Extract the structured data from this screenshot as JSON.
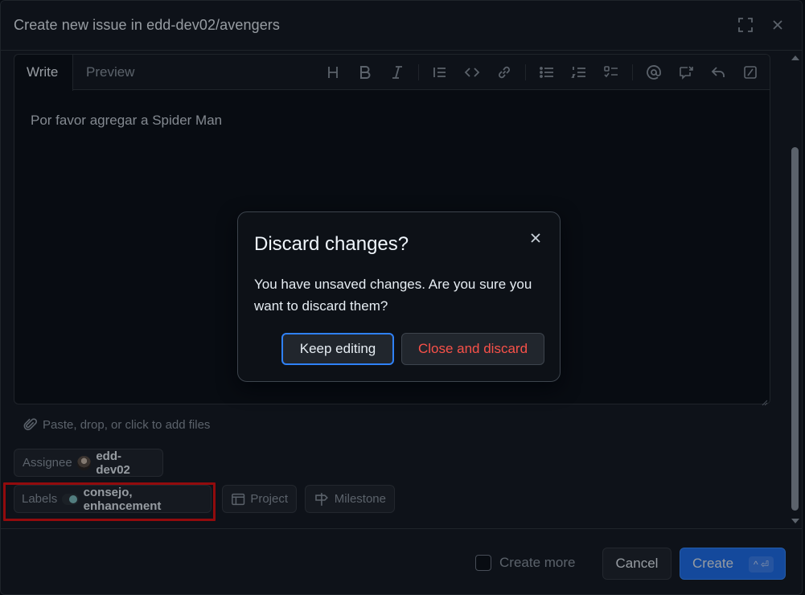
{
  "dialog": {
    "title": "Create new issue in edd-dev02/avengers"
  },
  "editor": {
    "tabs": [
      "Write",
      "Preview"
    ],
    "active_tab": "Write",
    "content": "Por favor agregar a Spider Man",
    "toolbar_icons": [
      "heading-icon",
      "bold-icon",
      "italic-icon",
      "quote-icon",
      "code-icon",
      "link-icon",
      "bulleted-list-icon",
      "numbered-list-icon",
      "task-list-icon",
      "mention-icon",
      "cross-reference-icon",
      "saved-reply-icon",
      "slash-command-icon"
    ]
  },
  "attach": {
    "text": "Paste, drop, or click to add files"
  },
  "metadata": {
    "assignee_label": "Assignee",
    "assignee_value": "edd-dev02",
    "labels_label": "Labels",
    "labels_value": "consejo, enhancement",
    "label_color": "#7fbfbf",
    "project_label": "Project",
    "milestone_label": "Milestone"
  },
  "footer": {
    "create_more_label": "Create more",
    "create_more_checked": false,
    "cancel_label": "Cancel",
    "create_label": "Create",
    "create_shortcut": "^ ⏎"
  },
  "modal": {
    "title": "Discard changes?",
    "message": "You have unsaved changes. Are you sure you want to discard them?",
    "keep_label": "Keep editing",
    "discard_label": "Close and discard"
  },
  "colors": {
    "accent": "#1f6feb",
    "danger": "#f85149",
    "highlight_box": "#e01010"
  }
}
